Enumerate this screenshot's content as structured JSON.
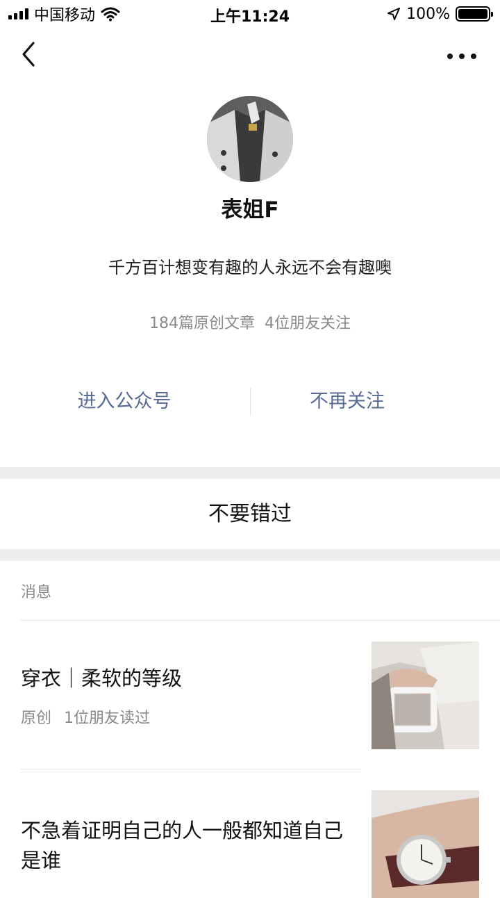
{
  "status_bar": {
    "carrier": "中国移动",
    "time": "上午11:24",
    "battery": "100%",
    "battery_level": 1.0
  },
  "nav": {
    "back_icon": "chevron-left-icon",
    "more_icon": "more-dots-icon"
  },
  "profile": {
    "name": "表姐F",
    "signature": "千方百计想变有趣的人永远不会有趣噢",
    "articles_count": "184篇原创文章",
    "friends_following": "4位朋友关注"
  },
  "actions": {
    "enter_account": "进入公众号",
    "unfollow": "不再关注"
  },
  "dont_miss": "不要错过",
  "messages": {
    "label": "消息",
    "items": [
      {
        "title": "穿衣｜柔软的等级",
        "tag": "原创",
        "meta": "1位朋友读过"
      },
      {
        "title": "不急着证明自己的人一般都知道自己是谁",
        "tag": "",
        "meta": ""
      }
    ]
  },
  "colors": {
    "link": "#576b95",
    "secondary_text": "#8a8a8a",
    "separator": "#ededed"
  }
}
